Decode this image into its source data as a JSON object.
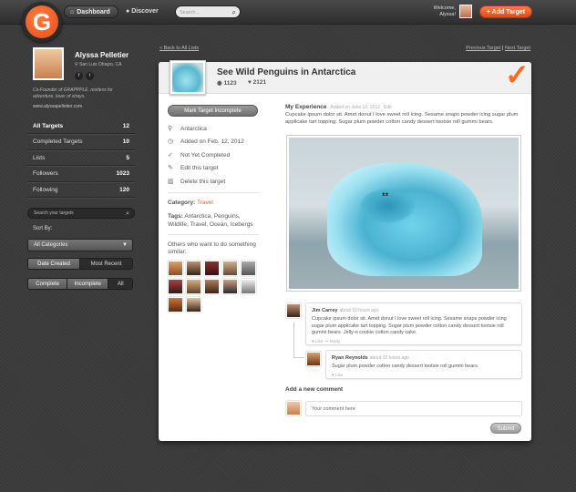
{
  "topbar": {
    "logo_letter": "G",
    "dashboard_label": "Dashboard",
    "discover_label": "Discover",
    "search_placeholder": "Search...",
    "welcome_line1": "Welcome,",
    "welcome_line2": "Alyssa!",
    "add_target_label": "+ Add Target",
    "accent_color": "#f05a1e"
  },
  "profile": {
    "name": "Alyssa Pelletier",
    "location": "San Luis Obispo, CA",
    "bio": "Co-Founder of GRAPPPLE, restless for adventure, lover of strays.",
    "website": "www.alyssapelletier.com",
    "social_icons": [
      "facebook-icon",
      "twitter-icon"
    ]
  },
  "stats": [
    {
      "label": "All Targets",
      "value": "12"
    },
    {
      "label": "Completed Targets",
      "value": "10"
    },
    {
      "label": "Lists",
      "value": "5"
    },
    {
      "label": "Followers",
      "value": "1023"
    },
    {
      "label": "Following",
      "value": "120"
    }
  ],
  "sidebar": {
    "search_placeholder": "Search your targets",
    "sort_by_label": "Sort By:",
    "category_value": "All Categories",
    "sort_options": [
      "Date Created",
      "Most Recent"
    ],
    "filter_options": [
      "Complete",
      "Incomplete",
      "All"
    ]
  },
  "nav": {
    "back_label": "« Back to All Lists",
    "previous_label": "Previous Target",
    "separator": "|",
    "next_label": "Next Target"
  },
  "target": {
    "title": "See Wild Penguins in Antarctica",
    "views": "1123",
    "likes": "2121",
    "mark_button": "Mark Target Incomplete",
    "location": "Antarctica",
    "added_on": "Added on Feb. 12, 2012",
    "status": "Not Yet Completed",
    "edit_label": "Edit this target",
    "delete_label": "Delete this target",
    "category_label": "Category:",
    "category_value": "Travel",
    "tags_label": "Tags:",
    "tags_value": "Antarctica, Penguins, Wildlife, Travel, Ocean, Icebergs",
    "others_label": "Others who want to do something similar:"
  },
  "experience": {
    "heading": "My Experience",
    "added": "Added on June 12, 2012",
    "edit": "Edit",
    "text": "Cupcake ipsum dolor sit. Amet donut I love sweet roll icing. Sesame snaps powder icing sugar plum applicake tart topping. Sugar plum powder cotton candy dessert tootsie roll gummi bears."
  },
  "comments": [
    {
      "name": "Jim Carrey",
      "ago": "about 10 hours ago",
      "text": "Cupcake ipsum dolor sit. Amet donut I love sweet roll icing. Sesame snaps powder icing sugar plum applicake tart topping. Sugar plum powder cotton candy dessert tootsie roll gummi bears. Jelly-o cookie cotton candy cake.",
      "like": "Like",
      "reply": "Reply"
    },
    {
      "name": "Ryan Reynolds",
      "ago": "about 10 hours ago",
      "text": "Sugar plum powder cotton candy dessert tootsie roll gummi bears.",
      "like": "Like"
    }
  ],
  "add_comment": {
    "heading": "Add a new comment",
    "placeholder": "Your comment here",
    "submit": "Submit"
  }
}
